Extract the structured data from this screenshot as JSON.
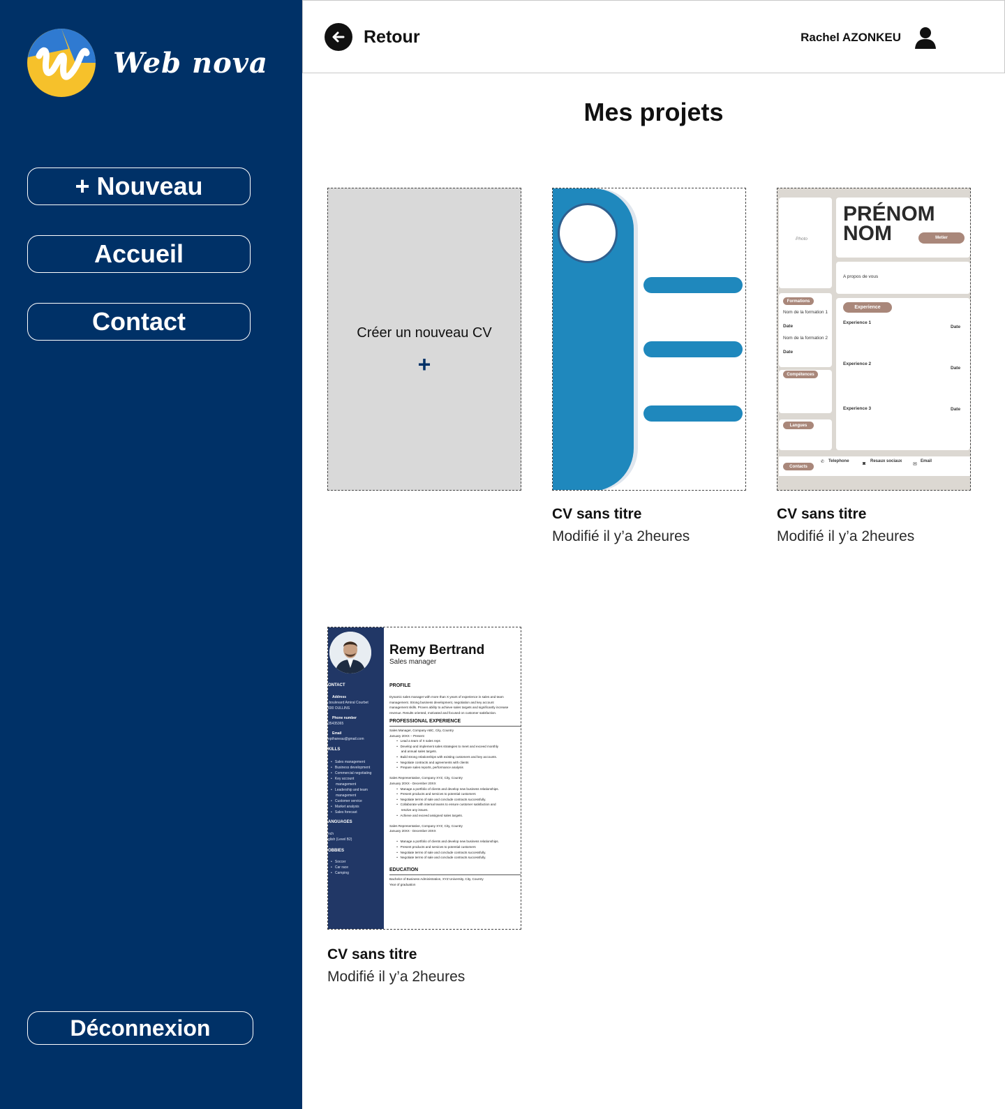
{
  "brand": {
    "name": "Web nova",
    "colors": {
      "navy": "#003167",
      "yellow": "#f6c12b",
      "blue": "#2f7ad1",
      "template_blue": "#1f88bd",
      "template_pill": "#a9877a"
    }
  },
  "nav": {
    "new_label": "+ Nouveau",
    "home_label": "Accueil",
    "contact_label": "Contact",
    "logout_label": "Déconnexion"
  },
  "header": {
    "back_label": "Retour",
    "user_name": "Rachel AZONKEU",
    "icons": [
      "back-arrow-icon",
      "user-icon"
    ]
  },
  "page": {
    "title": "Mes projets"
  },
  "new_card": {
    "label": "Créer un  nouveau CV",
    "plus": "+"
  },
  "projects": [
    {
      "title": "CV sans titre",
      "modified": "Modifié il y’a 2heures"
    },
    {
      "title": "CV sans titre",
      "modified": "Modifié il y’a 2heures"
    },
    {
      "title": "CV sans titre",
      "modified": "Modifié il y’a 2heures"
    }
  ],
  "template2": {
    "first_name": "PRÉNOM",
    "last_name": "NOM",
    "job": "Metier",
    "photo": "Photo",
    "about": "A propos de vous",
    "formations": "Formations",
    "formation1": "Nom de la formation 1",
    "formation2": "Nom de la formation 2",
    "date": "Date",
    "competences": "Compétences",
    "langues": "Langues",
    "experience": "Experience",
    "exp1": "Experience 1",
    "exp2": "Experience 2",
    "exp3": "Experience 3",
    "contacts": "Contacts",
    "telephone": "Telephone",
    "social": "Resaux sociaux",
    "email": "Email"
  },
  "template3": {
    "name": "Remy Bertrand",
    "role": "Sales manager",
    "contact": "ONTACT",
    "address_h": "Address",
    "address": " boulevard Amiral Courbet\n600 OULLINS",
    "phone_h": "Phone number",
    "phone": "35435365",
    "email_h": "Email",
    "email": "epthaneau@gmail.com",
    "skills_h": "KILLS",
    "skills": "•   Sales management\n•   Business development\n•   Commercial negotiating\n•   Key account\n     management\n•   Leadership and team\n     management\n•   Customer service\n•   Market analysis\n•   Sales forecast",
    "languages_h": "ANGUAGES",
    "languages": "nch\nglish (Level B2)",
    "hobbies_h": "OBBIES",
    "hobbies": "•   Soccer\n•   Car race\n•   Camping",
    "profile_h": "PROFILE",
    "profile": "Dynamic sales manager with more than X years of experience in sales and team\nmanagement. Strong business development, negotiation and key account\nmanagement skills. Proven ability to achieve sales targets and significantly increase\nrevenue. Results oriented, motivated and focused on customer satisfaction.",
    "experience_h": "PROFESSIONAL EXPERIENCE",
    "experience": "Sales Manager, Company ABC, City, Country\nJanuary 20XX – Present\n        •   Lead a team of X sales reps\n        •   Develop and implement sales strategies to meet and exceed monthly\n             and annual sales targets.\n        •   Build strong relationships with existing customers and key accounts.\n        •   Negotiate contracts and agreements with clients\n        •   Prepare sales reports, performance analysis\n\nSales Representative, Company XYZ, City, Country\nJanuary 20XX - December 20XX\n        •   Manage a portfolio of clients and develop new business relationships.\n        •   Present products and services to potential customers\n        •   Negotiate terms of sale and conclude contracts successfully.\n        •   Collaborate with internal teams to ensure customer satisfaction and\n             resolve any issues.\n        •   Achieve and exceed assigned sales targets.\n\nSales Representative, Company XYZ, City, Country\nJanuary 20XX - December 20XX\n\n        •   Manage a portfolio of clients and develop new business relationships.\n        •   Present products and services to potential customers\n        •   Negotiate terms of sale and conclude contracts successfully.\n        •   Negotiate terms of sale and conclude contracts successfully.",
    "education_h": "EDUCATION",
    "education": "Bachelor of Business Administration, XYZ University, City, Country\nYear of graduation"
  }
}
